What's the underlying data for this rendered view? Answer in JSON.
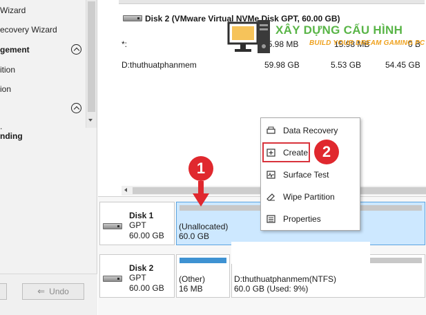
{
  "left_panel": {
    "items": [
      {
        "label": "Wizard"
      },
      {
        "label": "ecovery Wizard"
      }
    ],
    "sections": [
      {
        "label": "gement"
      },
      {
        "label": "ition"
      },
      {
        "label": "ion"
      }
    ],
    "pending_label": "nding",
    "undo_label": "Undo"
  },
  "partition_list": {
    "disk2_header": "Disk 2 (VMware Virtual NVMe Disk GPT, 60.00 GB)",
    "rows": [
      {
        "name": "*:",
        "capacity": "15.98 MB",
        "used": "15.98 MB",
        "unused": "0 B"
      },
      {
        "name": "D:thuthuatphanmem",
        "capacity": "59.98 GB",
        "used": "5.53 GB",
        "unused": "54.45 GB"
      }
    ]
  },
  "disk_map": {
    "disk1": {
      "name": "Disk 1",
      "type": "GPT",
      "size": "60.00 GB",
      "partitions": [
        {
          "label": "(Unallocated)",
          "size": "60.0 GB"
        }
      ]
    },
    "disk2": {
      "name": "Disk 2",
      "type": "GPT",
      "size": "60.00 GB",
      "partitions": [
        {
          "label": "(Other)",
          "size": "16 MB"
        },
        {
          "label": "D:thuthuatphanmem(NTFS)",
          "size": "60.0 GB (Used: 9%)",
          "used_fraction": 0.09
        }
      ]
    }
  },
  "context_menu": {
    "items": [
      {
        "label": "Data Recovery",
        "icon": "data-recovery-icon"
      },
      {
        "label": "Create",
        "icon": "create-icon"
      },
      {
        "label": "Surface Test",
        "icon": "surface-test-icon"
      },
      {
        "label": "Wipe Partition",
        "icon": "wipe-partition-icon"
      },
      {
        "label": "Properties",
        "icon": "properties-icon"
      }
    ]
  },
  "annotations": {
    "step1": "1",
    "step2": "2"
  },
  "watermark": {
    "title": "XÂY DỰNG CẤU HÌNH",
    "subtitle": "BUILD YOUR DREAM GAMING PC"
  },
  "colors": {
    "selection": "#cde8ff",
    "partition_used": "#3e92d2",
    "partition_free": "#c8c8c8",
    "annotation_red": "#e0282e",
    "watermark_green": "#59b547",
    "watermark_orange": "#efa21f"
  }
}
